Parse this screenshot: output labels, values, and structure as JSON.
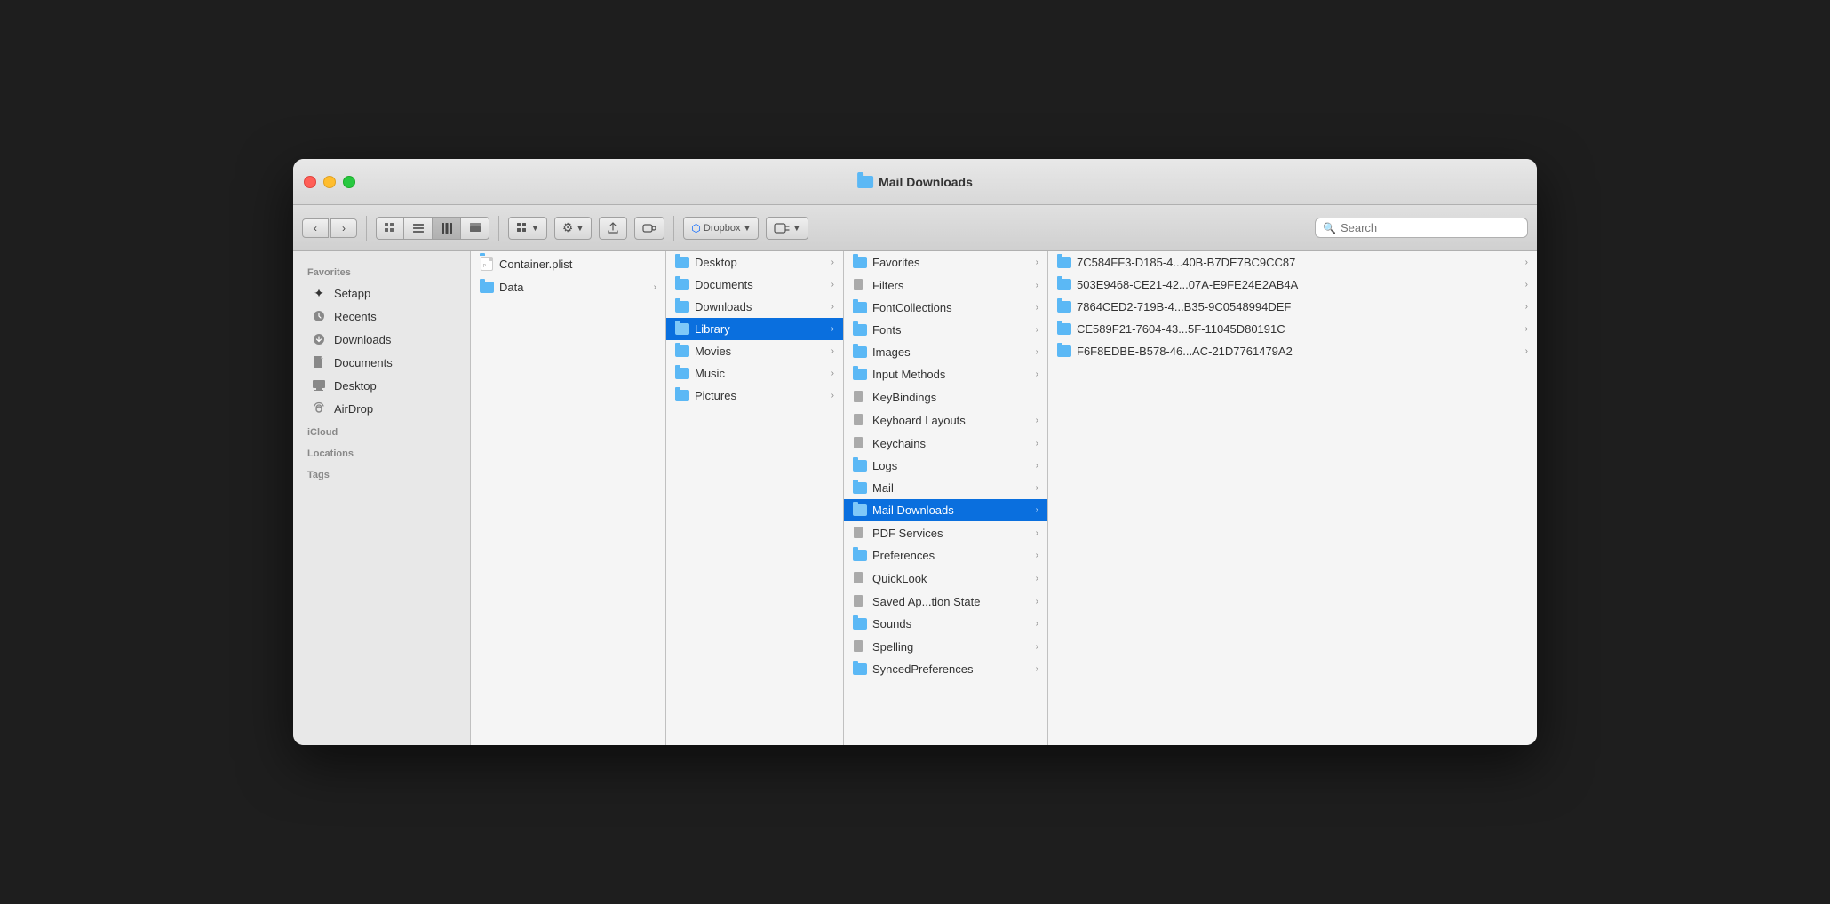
{
  "window": {
    "title": "Mail Downloads",
    "traffic_lights": {
      "red": "close",
      "yellow": "minimize",
      "green": "maximize"
    }
  },
  "toolbar": {
    "back_label": "‹",
    "forward_label": "›",
    "view_buttons": [
      "grid-icon",
      "list-icon",
      "column-icon",
      "coverflow-icon"
    ],
    "info_button": "ⓘ",
    "action_button": "⚙",
    "share_button": "↑",
    "tag_button": "○",
    "dropbox_button": "Dropbox",
    "more_button": "⋮",
    "search_placeholder": "Search"
  },
  "sidebar": {
    "favorites_label": "Favorites",
    "favorites_items": [
      {
        "id": "setapp",
        "label": "Setapp",
        "icon": "✦"
      },
      {
        "id": "recents",
        "label": "Recents",
        "icon": "🕐"
      },
      {
        "id": "downloads",
        "label": "Downloads",
        "icon": "⬇"
      },
      {
        "id": "documents",
        "label": "Documents",
        "icon": "📄"
      },
      {
        "id": "desktop",
        "label": "Desktop",
        "icon": "🖥"
      },
      {
        "id": "airdrop",
        "label": "AirDrop",
        "icon": "📡"
      }
    ],
    "icloud_label": "iCloud",
    "locations_label": "Locations",
    "tags_label": "Tags"
  },
  "column1": {
    "items": [
      {
        "id": "container-plist",
        "label": "Container.plist",
        "type": "plist",
        "has_arrow": false
      },
      {
        "id": "data",
        "label": "Data",
        "type": "folder",
        "has_arrow": true,
        "selected": false
      }
    ]
  },
  "column2": {
    "items": [
      {
        "id": "desktop",
        "label": "Desktop",
        "type": "folder",
        "has_arrow": true
      },
      {
        "id": "documents",
        "label": "Documents",
        "type": "folder",
        "has_arrow": true
      },
      {
        "id": "downloads",
        "label": "Downloads",
        "type": "folder",
        "has_arrow": true
      },
      {
        "id": "library",
        "label": "Library",
        "type": "folder",
        "has_arrow": true,
        "selected": true
      },
      {
        "id": "movies",
        "label": "Movies",
        "type": "folder",
        "has_arrow": true
      },
      {
        "id": "music",
        "label": "Music",
        "type": "folder",
        "has_arrow": true
      },
      {
        "id": "pictures",
        "label": "Pictures",
        "type": "folder",
        "has_arrow": true
      }
    ]
  },
  "column3": {
    "items": [
      {
        "id": "favorites",
        "label": "Favorites",
        "type": "folder",
        "has_arrow": true
      },
      {
        "id": "filters",
        "label": "Filters",
        "type": "plain",
        "has_arrow": true
      },
      {
        "id": "fontcollections",
        "label": "FontCollections",
        "type": "folder",
        "has_arrow": true
      },
      {
        "id": "fonts",
        "label": "Fonts",
        "type": "folder",
        "has_arrow": true
      },
      {
        "id": "images",
        "label": "Images",
        "type": "folder",
        "has_arrow": true
      },
      {
        "id": "input-methods",
        "label": "Input Methods",
        "type": "folder",
        "has_arrow": true
      },
      {
        "id": "keybindings",
        "label": "KeyBindings",
        "type": "plain",
        "has_arrow": false
      },
      {
        "id": "keyboard-layouts",
        "label": "Keyboard Layouts",
        "type": "plain",
        "has_arrow": true
      },
      {
        "id": "keychains",
        "label": "Keychains",
        "type": "plain",
        "has_arrow": true
      },
      {
        "id": "logs",
        "label": "Logs",
        "type": "folder",
        "has_arrow": true
      },
      {
        "id": "mail",
        "label": "Mail",
        "type": "folder",
        "has_arrow": true
      },
      {
        "id": "mail-downloads",
        "label": "Mail Downloads",
        "type": "folder",
        "has_arrow": true,
        "selected": true
      },
      {
        "id": "pdf-services",
        "label": "PDF Services",
        "type": "plain",
        "has_arrow": true
      },
      {
        "id": "preferences",
        "label": "Preferences",
        "type": "folder",
        "has_arrow": true
      },
      {
        "id": "quicklook",
        "label": "QuickLook",
        "type": "plain",
        "has_arrow": true
      },
      {
        "id": "saved-app-state",
        "label": "Saved Ap...tion State",
        "type": "plain",
        "has_arrow": true
      },
      {
        "id": "sounds",
        "label": "Sounds",
        "type": "folder",
        "has_arrow": true
      },
      {
        "id": "spelling",
        "label": "Spelling",
        "type": "plain",
        "has_arrow": true
      },
      {
        "id": "synced-preferences",
        "label": "SyncedPreferences",
        "type": "folder",
        "has_arrow": true
      }
    ]
  },
  "column4": {
    "items": [
      {
        "id": "hash1",
        "label": "7C584FF3-D185-4...40B-B7DE7BC9CC87",
        "type": "folder"
      },
      {
        "id": "hash2",
        "label": "503E9468-CE21-42...07A-E9FE24E2AB4A",
        "type": "folder"
      },
      {
        "id": "hash3",
        "label": "7864CED2-719B-4...B35-9C0548994DEF",
        "type": "folder"
      },
      {
        "id": "hash4",
        "label": "CE589F21-7604-43...5F-11045D80191C",
        "type": "folder"
      },
      {
        "id": "hash5",
        "label": "F6F8EDBE-B578-46...AC-21D7761479A2",
        "type": "folder"
      }
    ]
  },
  "colors": {
    "folder_blue": "#5bb8f5",
    "selected_blue": "#0a6fde",
    "sidebar_bg": "#e8e8e8"
  }
}
